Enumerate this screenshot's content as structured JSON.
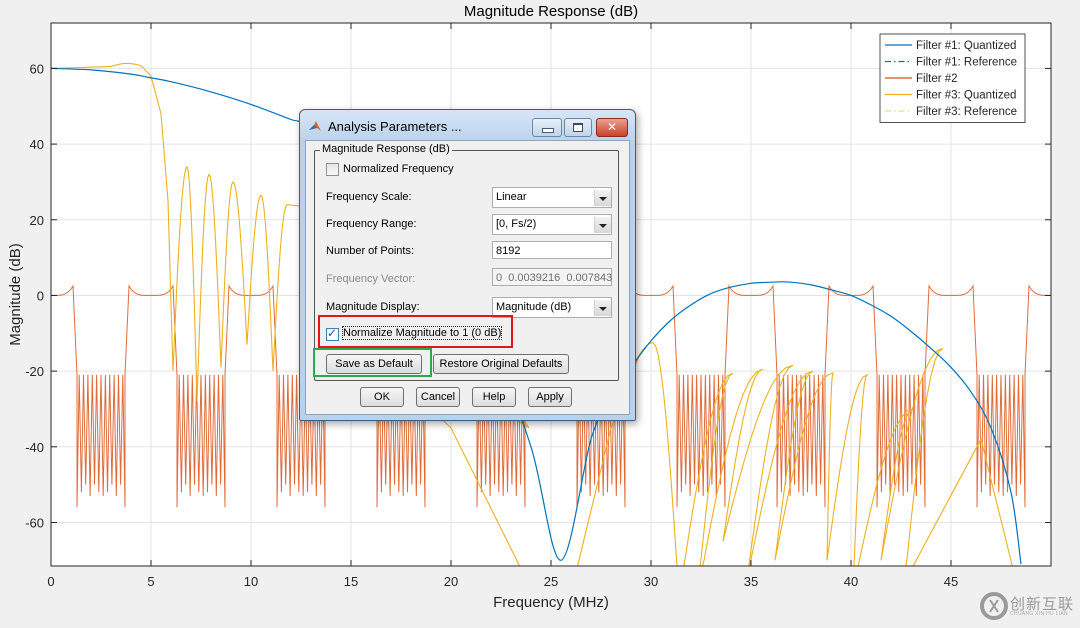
{
  "chart_data": {
    "type": "line",
    "title": "Magnitude Response (dB)",
    "xlabel": "Frequency (MHz)",
    "ylabel": "Magnitude (dB)",
    "xlim": [
      0,
      50
    ],
    "ylim": [
      -71.5,
      72
    ],
    "grid": true,
    "legend_position": "top-right",
    "xticks": [
      0,
      5,
      10,
      15,
      20,
      25,
      30,
      35,
      40,
      45
    ],
    "yticks": [
      -60,
      -40,
      -20,
      0,
      20,
      40,
      60
    ],
    "xtick_labels": [
      "0",
      "5",
      "10",
      "15",
      "20",
      "25",
      "30",
      "35",
      "40",
      "45"
    ],
    "ytick_labels": [
      "-60",
      "-40",
      "-20",
      "0",
      "20",
      "40",
      "60"
    ],
    "legend": [
      {
        "label": "Filter #1: Quantized",
        "color": "#0072bd",
        "style": "solid"
      },
      {
        "label": "Filter #1: Reference",
        "color": "#0072bd",
        "style": "dashdot"
      },
      {
        "label": "Filter #2",
        "color": "#d95319",
        "style": "solid"
      },
      {
        "label": "Filter #3: Quantized",
        "color": "#edb120",
        "style": "solid"
      },
      {
        "label": "Filter #3: Reference",
        "color": "#edb120",
        "style": "dashdot"
      }
    ],
    "series": [
      {
        "name": "Filter #1: Quantized",
        "color": "#0072bd",
        "description": "Smooth lowpass-like curve starting at 60 dB, falling to about 2 dB near 18 MHz, then a broad lobe peaking ~3.5 dB at ~36.5 MHz and dropping below -70 dB near 48.5 MHz",
        "x": [
          0,
          2,
          4,
          5,
          6,
          8,
          10,
          12,
          13,
          16,
          18,
          20,
          22,
          24,
          25.5,
          27,
          28,
          29,
          30,
          31,
          32,
          33,
          34,
          35,
          36,
          36.5,
          37,
          38,
          39,
          40,
          41,
          42,
          43,
          44,
          45,
          46,
          47,
          48,
          48.5
        ],
        "y": [
          60,
          59.6,
          58.5,
          57.5,
          56.5,
          53.8,
          50.5,
          46.5,
          44.5,
          32,
          22,
          8,
          -12,
          -40,
          -70,
          -38,
          -27,
          -19,
          -12,
          -6.5,
          -2.5,
          0.5,
          2.2,
          3.2,
          3.5,
          3.6,
          3.5,
          2.8,
          1.5,
          0,
          -2.5,
          -5.5,
          -9.5,
          -14,
          -19,
          -25.5,
          -35,
          -52,
          -71
        ]
      },
      {
        "name": "Filter #3: Quantized",
        "color": "#edb120",
        "description": "Lowpass with ~60.5 dB passband to ~4.5 MHz, stopband ripples with lobe peaks descending from ~34 dB to ~22 dB, and deep nulls; similar lobes from ~-12 to -30 dB in upper band",
        "passband": {
          "x_end": 4.5,
          "level": 60.5
        },
        "sidelobe_peaks": [
          {
            "x": 6.8,
            "y": 34
          },
          {
            "x": 7.9,
            "y": 32
          },
          {
            "x": 9.1,
            "y": 30
          },
          {
            "x": 10.5,
            "y": 26.5
          },
          {
            "x": 11.8,
            "y": 24
          },
          {
            "x": 30.1,
            "y": -12.5
          },
          {
            "x": 34.1,
            "y": -20.5
          },
          {
            "x": 35.6,
            "y": -19.5
          },
          {
            "x": 37.1,
            "y": -18.5
          },
          {
            "x": 38.1,
            "y": -20
          },
          {
            "x": 39.1,
            "y": -20.5
          },
          {
            "x": 40.8,
            "y": -21
          },
          {
            "x": 43.1,
            "y": -30
          },
          {
            "x": 44.6,
            "y": -14
          }
        ],
        "nulls_x": [
          6.1,
          7.3,
          8.5,
          9.8,
          11.1,
          23.9,
          26.1,
          31.4,
          32.3,
          33.6,
          34.8,
          36.2,
          38.8,
          40.1,
          41.5,
          42.6,
          43.6,
          48.3
        ]
      },
      {
        "name": "Filter #2",
        "color": "#d95319",
        "description": "Periodic comb-like response (period 5 MHz): passbands at 0 dB with +2.5 dB edge peaks, sharp transitions, stopbands around -21 dB with dense nulls reaching -50 to -56 dB",
        "period_mhz": 5,
        "passband_level_db": 0,
        "passband_edge_peak_db": 2.5,
        "stopband_top_db": -21,
        "stopband_null_db": [
          -50,
          -56
        ],
        "stopband_intervals_mhz": [
          [
            1.3,
            3.7
          ],
          [
            6.3,
            8.7
          ],
          [
            11.3,
            13.7
          ],
          [
            16.3,
            18.7
          ],
          [
            21.3,
            23.7
          ],
          [
            26.3,
            28.7
          ],
          [
            31.3,
            33.7
          ],
          [
            36.3,
            38.7
          ],
          [
            41.3,
            43.7
          ],
          [
            46.3,
            48.7
          ]
        ]
      }
    ]
  },
  "dialog": {
    "title": "Analysis Parameters ...",
    "group_label": "Magnitude Response (dB)",
    "normalized_frequency_label": "Normalized Frequency",
    "normalized_frequency_checked": false,
    "frequency_scale_label": "Frequency Scale:",
    "frequency_scale_value": "Linear",
    "frequency_range_label": "Frequency Range:",
    "frequency_range_value": "[0, Fs/2)",
    "number_of_points_label": "Number of Points:",
    "number_of_points_value": "8192",
    "frequency_vector_label": "Frequency Vector:",
    "frequency_vector_value": "0  0.0039216  0.007843",
    "magnitude_display_label": "Magnitude Display:",
    "magnitude_display_value": "Magnitude (dB)",
    "normalize_magnitude_label": "Normalize Magnitude to 1 (0 dB)",
    "normalize_magnitude_checked": true,
    "save_default_label": "Save as Default",
    "restore_defaults_label": "Restore Original Defaults",
    "ok_label": "OK",
    "cancel_label": "Cancel",
    "help_label": "Help",
    "apply_label": "Apply",
    "close_glyph": "✕"
  },
  "watermark": {
    "text": "创新互联",
    "subtext": "CHUANG XIN HU LIAN"
  },
  "colors": {
    "filter1": "#0072bd",
    "filter2": "#d95319",
    "filter3": "#edb120",
    "highlight_red": "#e0161c",
    "highlight_green": "#2da84a"
  }
}
